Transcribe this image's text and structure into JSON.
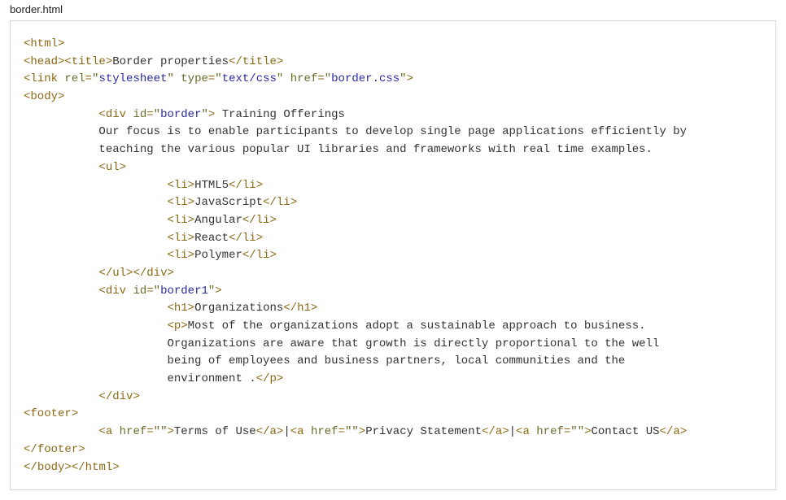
{
  "filename": "border.html",
  "code": {
    "tags": {
      "html": "html",
      "head": "head",
      "title": "title",
      "link": "link",
      "body": "body",
      "div": "div",
      "ul": "ul",
      "li": "li",
      "h1": "h1",
      "p": "p",
      "footer": "footer",
      "a": "a"
    },
    "attrs": {
      "rel": "rel",
      "type": "type",
      "href": "href",
      "id": "id"
    },
    "vals": {
      "stylesheet": "stylesheet",
      "textcss": "text/css",
      "bordercss": "border.css",
      "border": "border",
      "border1": "border1",
      "empty": ""
    },
    "text": {
      "title": "Border properties",
      "div1_head": " Training Offerings",
      "div1_para_l1": "Our focus is to enable participants to develop single page applications efficiently by",
      "div1_para_l2": "teaching the various popular UI libraries and frameworks with real time examples.",
      "li1": "HTML5",
      "li2": "JavaScript",
      "li3": "Angular",
      "li4": "React",
      "li5": "Polymer",
      "h1": "Organizations",
      "p_l1": "Most of the organizations adopt a sustainable approach to business.",
      "p_l2": "Organizations are aware that growth is directly proportional to the well",
      "p_l3": "being of employees and business partners, local communities and the",
      "p_l4": "environment .",
      "ftr_a1": "Terms of Use",
      "ftr_a2": "Privacy Statement",
      "ftr_a3": "Contact US",
      "pipe": "|"
    }
  }
}
